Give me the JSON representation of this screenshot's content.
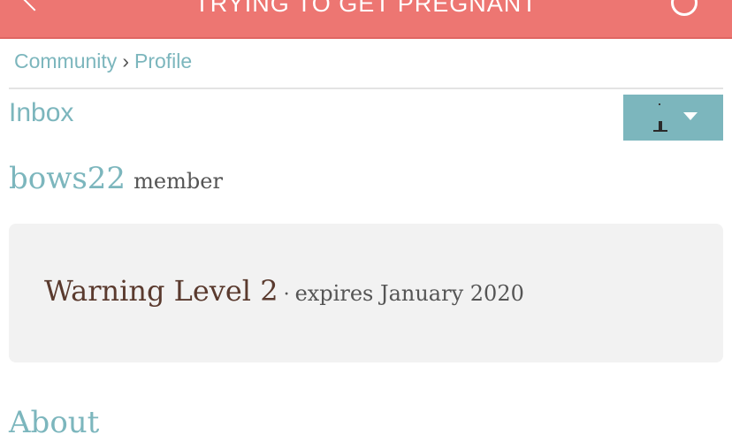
{
  "header": {
    "title": "TRYING TO GET PREGNANT",
    "back_icon": "chevron-left-icon",
    "refresh_icon": "refresh-icon",
    "background_color": "#ed7672"
  },
  "breadcrumb": {
    "items": [
      "Community",
      "Profile"
    ],
    "separator": "›"
  },
  "inbox": {
    "label": "Inbox"
  },
  "user_menu": {
    "avatar_icon": "avatar-icon",
    "caret_icon": "caret-down-icon",
    "background_color": "#7cb6bd"
  },
  "profile": {
    "username": "bows22",
    "role": "member"
  },
  "warning": {
    "level": "Warning Level 2",
    "separator": "·",
    "expiry": "expires January 2020"
  },
  "about": {
    "heading": "About"
  },
  "colors": {
    "accent": "#7cb6bd",
    "warning_text": "#5a3a2e",
    "card_background": "#f2f2f2"
  }
}
